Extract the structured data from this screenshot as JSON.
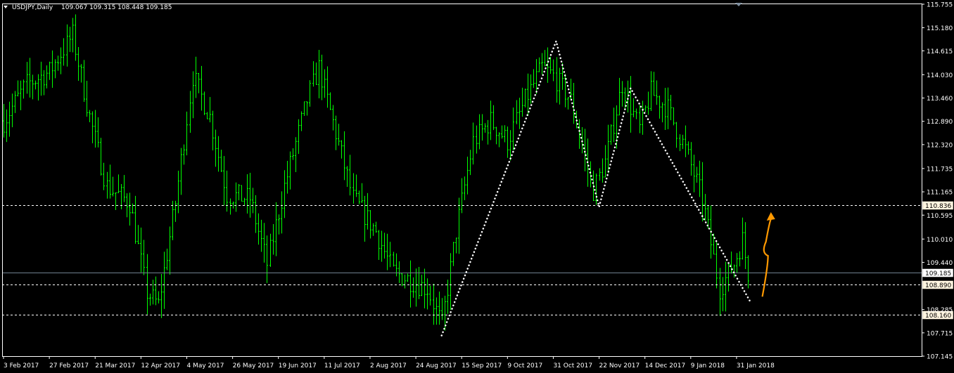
{
  "header": {
    "symbol_label": "USDJPY,Daily",
    "ohlc_label": "109.067 109.315 108.448 109.185"
  },
  "colors": {
    "background": "#000000",
    "bars": "#00ff00",
    "axis": "#ffffff",
    "hline": "#ffffff",
    "current_line": "#708090",
    "label_box": "#fff5e0",
    "arrow": "#ff9900",
    "pattern": "#ffffff"
  },
  "chart_data": {
    "type": "ohlc",
    "title": "USDJPY,Daily",
    "ylim": [
      107.145,
      115.755
    ],
    "y_ticks": [
      {
        "value": 115.755,
        "label": "115.755"
      },
      {
        "value": 115.18,
        "label": "115.180"
      },
      {
        "value": 114.615,
        "label": "114.615"
      },
      {
        "value": 114.03,
        "label": "114.030"
      },
      {
        "value": 113.46,
        "label": "113.460"
      },
      {
        "value": 112.89,
        "label": "112.890"
      },
      {
        "value": 112.32,
        "label": "112.320"
      },
      {
        "value": 111.735,
        "label": "111.735"
      },
      {
        "value": 111.165,
        "label": "111.165"
      },
      {
        "value": 110.595,
        "label": "110.595"
      },
      {
        "value": 110.01,
        "label": "110.010"
      },
      {
        "value": 109.44,
        "label": "109.440"
      },
      {
        "value": 108.285,
        "label": "108.285"
      },
      {
        "value": 107.715,
        "label": "107.715"
      },
      {
        "value": 107.145,
        "label": "107.145"
      }
    ],
    "x_ticks": [
      {
        "index": 0,
        "label": "3 Feb 2017"
      },
      {
        "index": 16,
        "label": "27 Feb 2017"
      },
      {
        "index": 32,
        "label": "21 Mar 2017"
      },
      {
        "index": 48,
        "label": "12 Apr 2017"
      },
      {
        "index": 64,
        "label": "4 May 2017"
      },
      {
        "index": 80,
        "label": "26 May 2017"
      },
      {
        "index": 96,
        "label": "19 Jun 2017"
      },
      {
        "index": 112,
        "label": "11 Jul 2017"
      },
      {
        "index": 128,
        "label": "2 Aug 2017"
      },
      {
        "index": 144,
        "label": "24 Aug 2017"
      },
      {
        "index": 160,
        "label": "15 Sep 2017"
      },
      {
        "index": 176,
        "label": "9 Oct 2017"
      },
      {
        "index": 192,
        "label": "31 Oct 2017"
      },
      {
        "index": 208,
        "label": "22 Nov 2017"
      },
      {
        "index": 224,
        "label": "14 Dec 2017"
      },
      {
        "index": 240,
        "label": "9 Jan 2018"
      },
      {
        "index": 256,
        "label": "31 Jan 2018"
      }
    ],
    "bar_count": 261,
    "anchors": [
      [
        0,
        112.9
      ],
      [
        8,
        113.8
      ],
      [
        16,
        114.1
      ],
      [
        24,
        115.0
      ],
      [
        30,
        113.0
      ],
      [
        36,
        111.3
      ],
      [
        44,
        110.9
      ],
      [
        50,
        108.7
      ],
      [
        54,
        108.4
      ],
      [
        60,
        110.9
      ],
      [
        66,
        114.0
      ],
      [
        72,
        113.0
      ],
      [
        78,
        111.1
      ],
      [
        86,
        111.0
      ],
      [
        92,
        109.4
      ],
      [
        98,
        111.3
      ],
      [
        106,
        113.4
      ],
      [
        110,
        114.2
      ],
      [
        116,
        112.6
      ],
      [
        122,
        111.0
      ],
      [
        130,
        110.2
      ],
      [
        136,
        109.2
      ],
      [
        142,
        109.0
      ],
      [
        148,
        108.8
      ],
      [
        153,
        107.9
      ],
      [
        158,
        110.2
      ],
      [
        164,
        112.4
      ],
      [
        170,
        112.9
      ],
      [
        176,
        112.4
      ],
      [
        182,
        113.4
      ],
      [
        188,
        114.2
      ],
      [
        192,
        114.0
      ],
      [
        198,
        113.4
      ],
      [
        206,
        111.2
      ],
      [
        210,
        111.9
      ],
      [
        216,
        113.8
      ],
      [
        222,
        112.7
      ],
      [
        226,
        113.6
      ],
      [
        232,
        113.2
      ],
      [
        238,
        112.2
      ],
      [
        244,
        111.0
      ],
      [
        250,
        108.8
      ],
      [
        255,
        109.4
      ],
      [
        258,
        110.0
      ],
      [
        260,
        109.185
      ]
    ],
    "price_lines": [
      {
        "value": 110.836,
        "label": "110.836",
        "style": "dashed"
      },
      {
        "value": 109.185,
        "label": "109.185",
        "style": "solid",
        "current": true
      },
      {
        "value": 108.89,
        "label": "108.890",
        "style": "dashed"
      },
      {
        "value": 108.16,
        "label": "108.160",
        "style": "dashed"
      }
    ],
    "pattern_polyline": [
      {
        "x": 153,
        "y": 107.65
      },
      {
        "x": 193,
        "y": 114.85
      },
      {
        "x": 208,
        "y": 110.8
      },
      {
        "x": 219,
        "y": 113.7
      },
      {
        "x": 261,
        "y": 108.45
      }
    ],
    "arrow": {
      "from": {
        "x": 265,
        "y": 108.6
      },
      "to": {
        "x": 268,
        "y": 110.6
      }
    }
  }
}
